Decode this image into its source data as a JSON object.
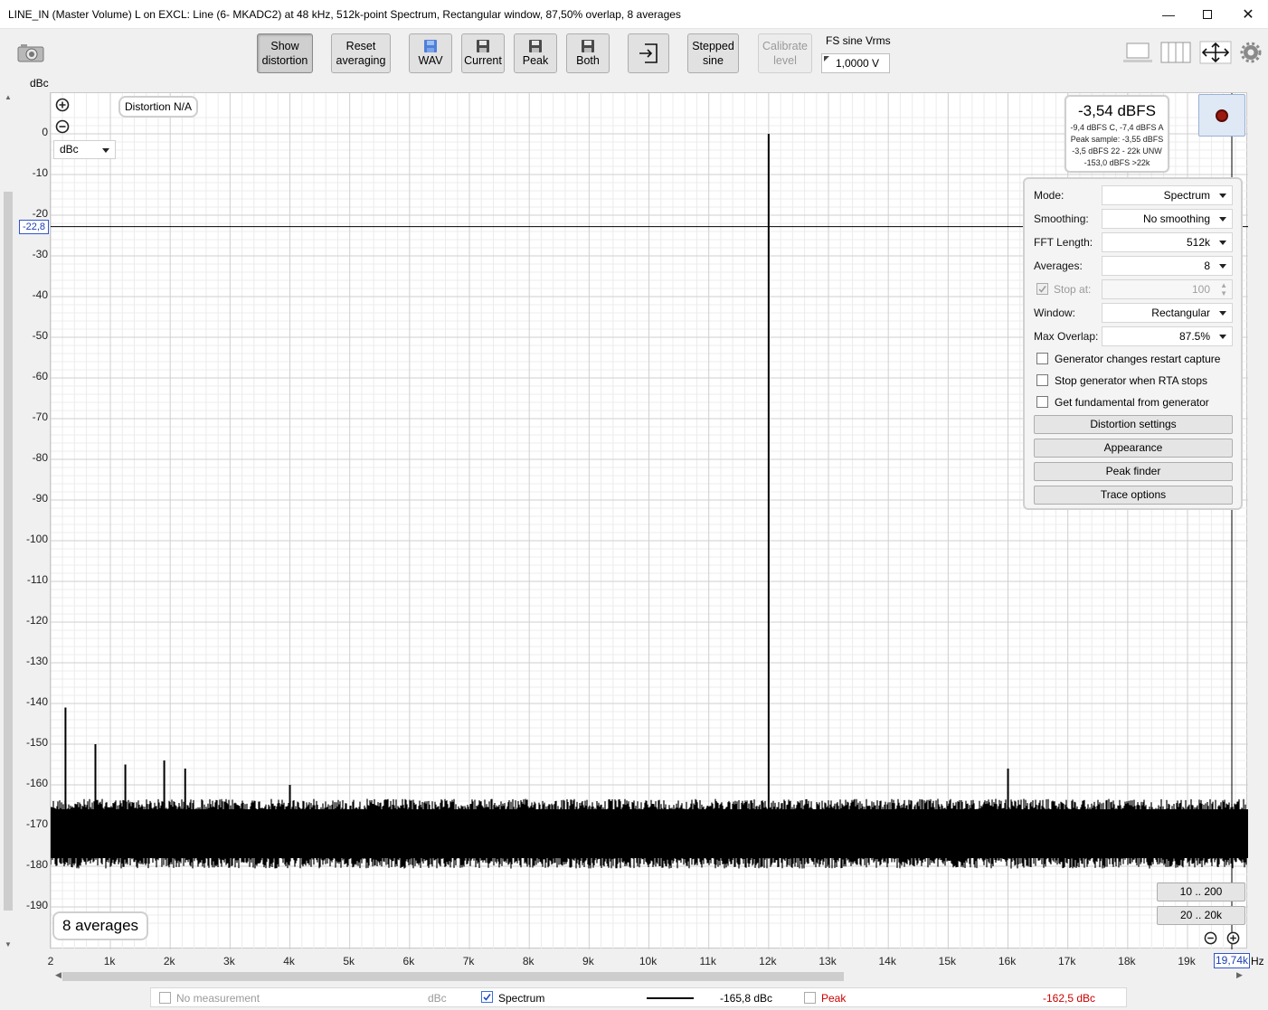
{
  "window": {
    "title": "LINE_IN (Master Volume) L on EXCL: Line (6- MKADC2) at 48 kHz, 512k-point Spectrum, Rectangular window, 87,50% overlap, 8 averages",
    "minimize_icon": "minimize-icon",
    "maximize_icon": "maximize-icon",
    "close_icon": "close-icon"
  },
  "toolbar": {
    "show_distortion": [
      "Show",
      "distortion"
    ],
    "reset_averaging": [
      "Reset",
      "averaging"
    ],
    "wav": "WAV",
    "current": "Current",
    "peak": "Peak",
    "both": "Both",
    "stepped_sine": [
      "Stepped",
      "sine"
    ],
    "calibrate_level": [
      "Calibrate",
      "level"
    ],
    "fs_label": "FS sine Vrms",
    "fs_value": "1,0000 V"
  },
  "plot": {
    "y_unit": "dBc",
    "x_unit": "Hz",
    "distortion_label": "Distortion N/A",
    "unit_select": "dBc",
    "cursor_y_value": "-22,8",
    "cursor_x_value": "19,74k",
    "averages_badge": "8 averages",
    "range_buttons": [
      "10 .. 200",
      "20 .. 20k"
    ]
  },
  "readout": {
    "main": "-3,54 dBFS",
    "lines": [
      "-9,4 dBFS C, -7,4 dBFS A",
      "Peak sample: -3,55 dBFS",
      "-3,5 dBFS 22 - 22k UNW",
      "-153,0 dBFS >22k"
    ]
  },
  "panel": {
    "mode_label": "Mode:",
    "mode_value": "Spectrum",
    "smoothing_label": "Smoothing:",
    "smoothing_value": "No smoothing",
    "fft_label": "FFT Length:",
    "fft_value": "512k",
    "averages_label": "Averages:",
    "averages_value": "8",
    "stopat_label": "Stop at:",
    "stopat_value": "100",
    "window_label": "Window:",
    "window_value": "Rectangular",
    "overlap_label": "Max Overlap:",
    "overlap_value": "87.5%",
    "cb_restart": "Generator changes restart capture",
    "cb_stopgen": "Stop generator when RTA stops",
    "cb_fundamental": "Get fundamental from generator",
    "btn_distortion": "Distortion settings",
    "btn_appearance": "Appearance",
    "btn_peakfinder": "Peak finder",
    "btn_traceoptions": "Trace options"
  },
  "legend": {
    "no_measurement": "No measurement",
    "no_measurement_unit": "dBc",
    "spectrum": "Spectrum",
    "spectrum_value": "-165,8 dBc",
    "peak": "Peak",
    "peak_value": "-162,5 dBc",
    "peak_color": "#cc0000"
  },
  "chart_data": {
    "type": "line",
    "title": "",
    "xlabel": "Hz",
    "ylabel": "dBc",
    "xlim": [
      2,
      20000
    ],
    "ylim": [
      -195,
      5
    ],
    "y_ticks": [
      0,
      -10,
      -20,
      -30,
      -40,
      -50,
      -60,
      -70,
      -80,
      -90,
      -100,
      -110,
      -120,
      -130,
      -140,
      -150,
      -160,
      -170,
      -180,
      -190
    ],
    "x_ticks": [
      "2",
      "1k",
      "2k",
      "3k",
      "4k",
      "5k",
      "6k",
      "7k",
      "8k",
      "9k",
      "10k",
      "11k",
      "12k",
      "13k",
      "14k",
      "15k",
      "16k",
      "17k",
      "18k",
      "19k"
    ],
    "x_tick_values": [
      2,
      1000,
      2000,
      3000,
      4000,
      5000,
      6000,
      7000,
      8000,
      9000,
      10000,
      11000,
      12000,
      13000,
      14000,
      15000,
      16000,
      17000,
      18000,
      19000
    ],
    "series": [
      {
        "name": "Spectrum",
        "noise_floor_band": [
          -181,
          -163
        ],
        "peaks": [
          {
            "x": 12000,
            "y": 0
          },
          {
            "x": 250,
            "y": -141
          },
          {
            "x": 750,
            "y": -150
          },
          {
            "x": 1250,
            "y": -155
          },
          {
            "x": 1900,
            "y": -154
          },
          {
            "x": 2250,
            "y": -156
          },
          {
            "x": 4000,
            "y": -160
          },
          {
            "x": 16000,
            "y": -156
          }
        ]
      }
    ],
    "cursor": {
      "y": -22.8,
      "x": 19740
    }
  }
}
